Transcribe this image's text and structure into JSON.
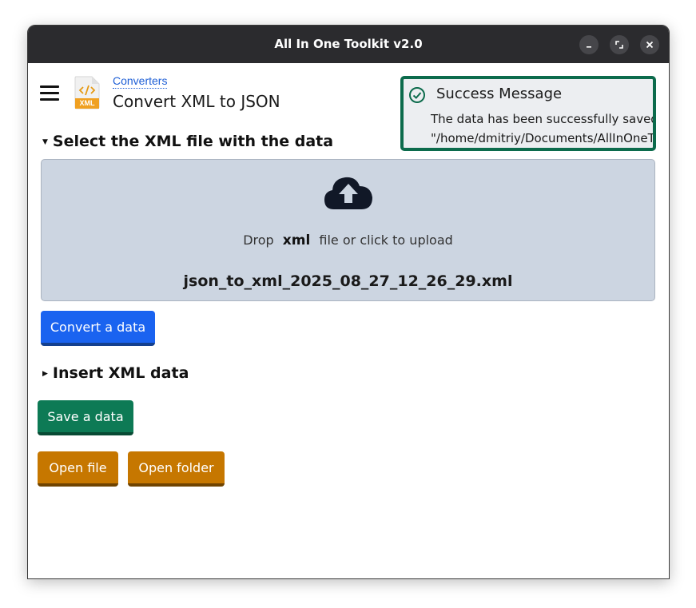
{
  "window": {
    "title": "All In One Toolkit v2.0"
  },
  "header": {
    "breadcrumb": "Converters",
    "page_title": "Convert XML to JSON",
    "app_icon_label": "XML"
  },
  "toast": {
    "title": "Success Message",
    "line1": "The data has been successfully saved",
    "line2": "\"/home/dmitriy/Documents/AllInOneToolkit"
  },
  "sections": {
    "select_file": "Select the XML file with the data",
    "insert_data": "Insert XML data"
  },
  "dropzone": {
    "hint_before": "Drop",
    "hint_format": "xml",
    "hint_after": "file or click to upload",
    "filename": "json_to_xml_2025_08_27_12_26_29.xml"
  },
  "buttons": {
    "convert": "Convert a data",
    "save": "Save a data",
    "open_file": "Open file",
    "open_folder": "Open folder"
  },
  "colors": {
    "titlebar": "#2b2b2e",
    "primary": "#1a63f0",
    "success": "#0d7a55",
    "warning": "#c67700",
    "dropzone": "#ccd5e1"
  },
  "icons": {
    "menu": "hamburger-menu-icon",
    "app": "xml-file-icon",
    "theme": "sun-icon",
    "toast": "check-circle-icon",
    "upload": "cloud-upload-icon"
  }
}
